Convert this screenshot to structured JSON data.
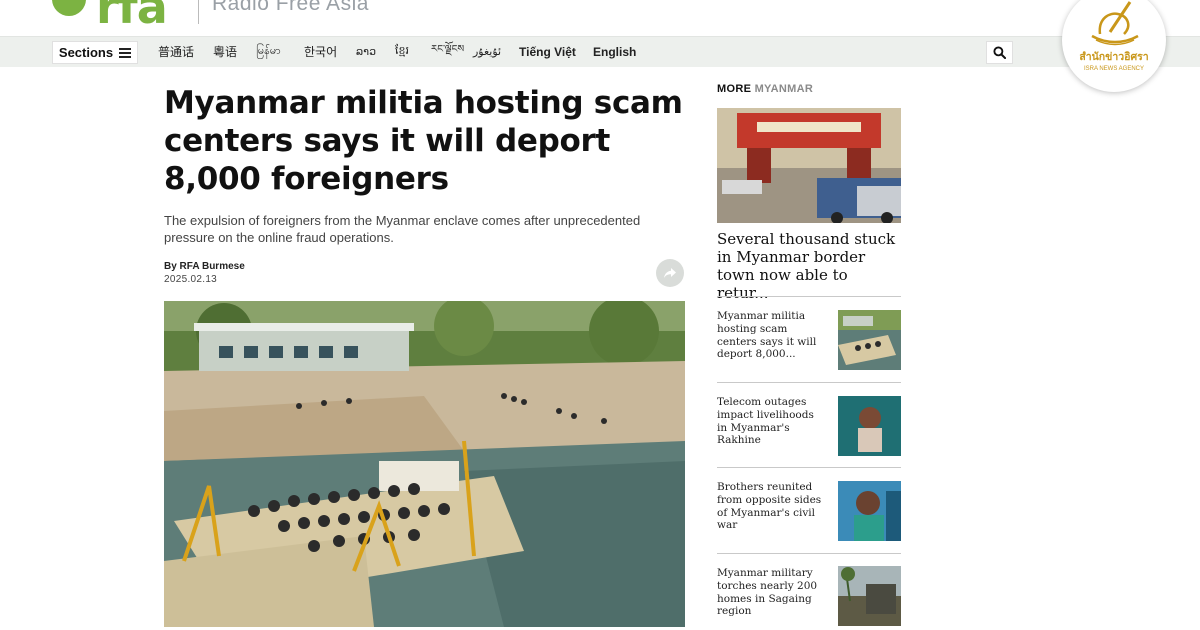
{
  "brand": {
    "logo_text": "rfa",
    "name": "Radio Free Asia"
  },
  "nav": {
    "sections_label": "Sections",
    "languages": [
      "普通话",
      "粵语",
      "မြန်မာ",
      "한국어",
      "ລາວ",
      "ខ្មែរ",
      "རང་ལྗོངས",
      "ئۇيغۇر",
      "Tiếng Việt",
      "English"
    ]
  },
  "article": {
    "headline": "Myanmar militia hosting scam centers says it will deport 8,000 foreigners",
    "dek": "The expulsion of foreigners from the Myanmar enclave comes after unprecedented pressure on the online fraud operations.",
    "byline": "By RFA Burmese",
    "date": "2025.02.13"
  },
  "sidebar": {
    "more_label": "MORE",
    "more_section": "MYANMAR",
    "top_story": "Several thousand stuck in Myanmar border town now able to retur...",
    "items": [
      {
        "title": "Myanmar militia hosting scam centers says it will deport 8,000..."
      },
      {
        "title": "Telecom outages impact livelihoods in Myanmar's Rakhine"
      },
      {
        "title": "Brothers reunited from opposite sides of Myanmar's civil war"
      },
      {
        "title": "Myanmar military torches nearly 200 homes in Sagaing region"
      }
    ]
  },
  "watermark": {
    "thai_text": "สำนักข่าวอิศรา",
    "english_text": "ISRA NEWS AGENCY"
  },
  "colors": {
    "brand_green": "#7cb342",
    "nav_bg": "#edf0ed",
    "badge_gold": "#c9971a"
  }
}
